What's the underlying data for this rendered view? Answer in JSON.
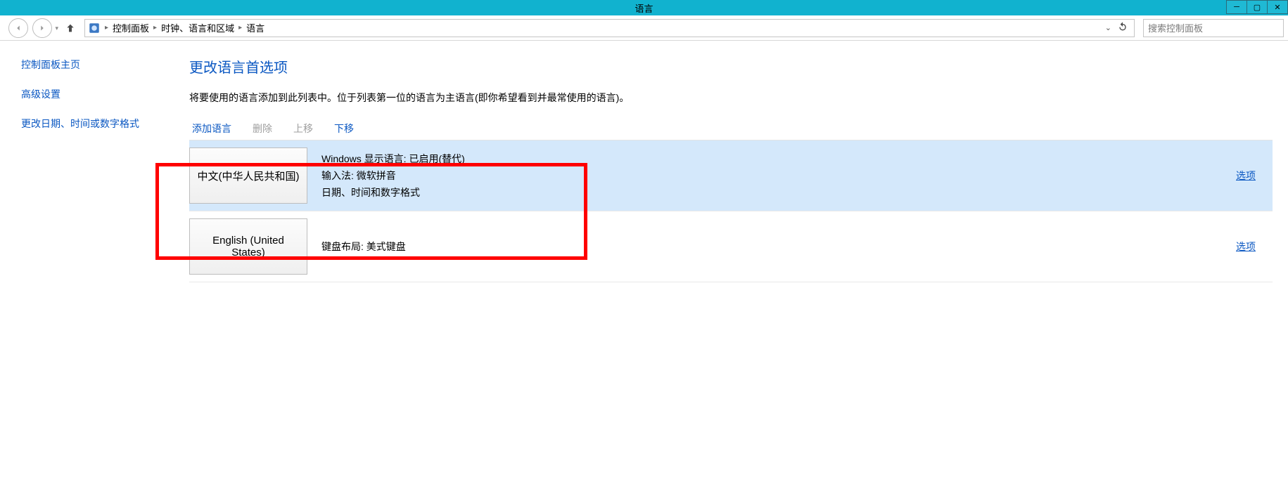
{
  "window": {
    "title": "语言"
  },
  "breadcrumbs": {
    "root": "控制面板",
    "mid": "时钟、语言和区域",
    "leaf": "语言"
  },
  "search": {
    "placeholder": "搜索控制面板"
  },
  "sidebar": {
    "home": "控制面板主页",
    "advanced": "高级设置",
    "dateformat": "更改日期、时间或数字格式"
  },
  "page": {
    "title": "更改语言首选项",
    "description": "将要使用的语言添加到此列表中。位于列表第一位的语言为主语言(即你希望看到并最常使用的语言)。"
  },
  "actions": {
    "add": "添加语言",
    "remove": "删除",
    "up": "上移",
    "down": "下移"
  },
  "languages": [
    {
      "tile": "中文(中华人民共和国)",
      "lines": [
        "Windows 显示语言: 已启用(替代)",
        "输入法: 微软拼音",
        "日期、时间和数字格式"
      ],
      "options": "选项",
      "selected": true
    },
    {
      "tile": "English (United States)",
      "lines": [
        "键盘布局: 美式键盘"
      ],
      "options": "选项",
      "selected": false
    }
  ]
}
